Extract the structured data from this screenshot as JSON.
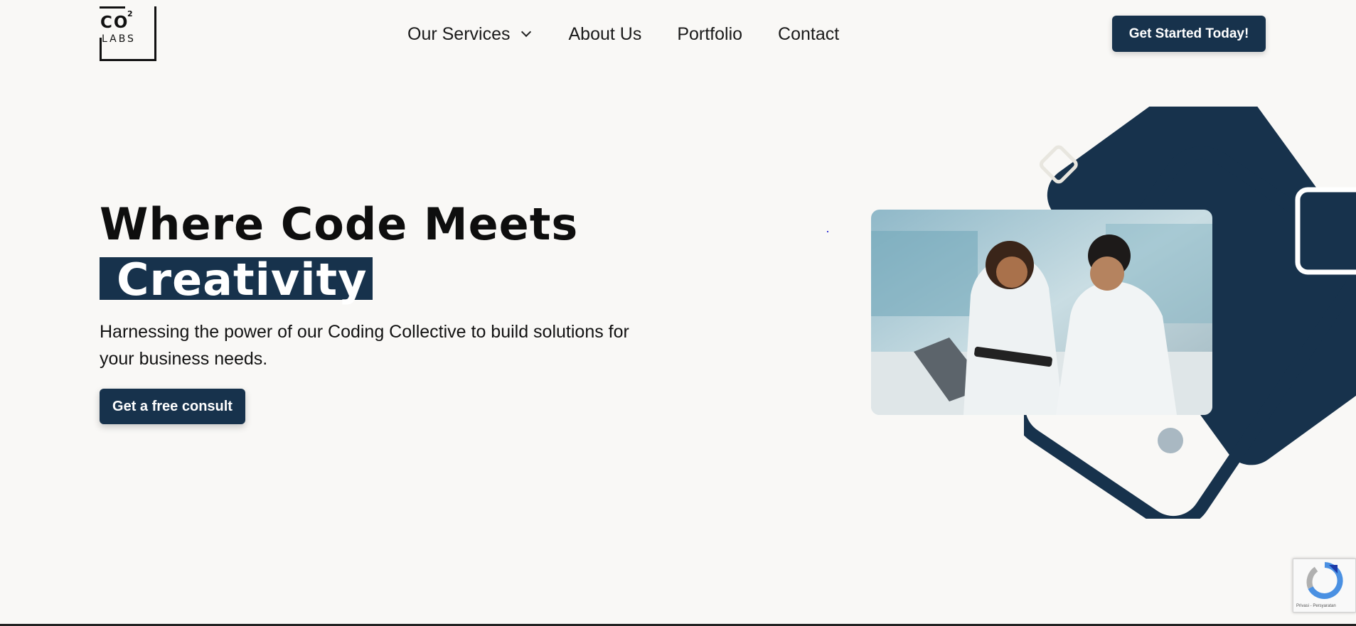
{
  "brand": {
    "logo_top": "CO",
    "logo_sup": "2",
    "logo_bottom": "LABS",
    "primary_color": "#17324c",
    "background_color": "#f9f8f6"
  },
  "nav": {
    "items": [
      {
        "label": "Our Services",
        "has_dropdown": true
      },
      {
        "label": "About Us"
      },
      {
        "label": "Portfolio"
      },
      {
        "label": "Contact"
      }
    ],
    "cta_label": "Get Started Today!"
  },
  "hero": {
    "title_line1": "Where Code Meets",
    "title_highlight": "Creativity",
    "subtitle": "Harnessing the power of our Coding Collective to build solutions for your business needs.",
    "cta_label": "Get a free consult"
  },
  "recaptcha": {
    "label": "Privasi - Persyaratan"
  }
}
